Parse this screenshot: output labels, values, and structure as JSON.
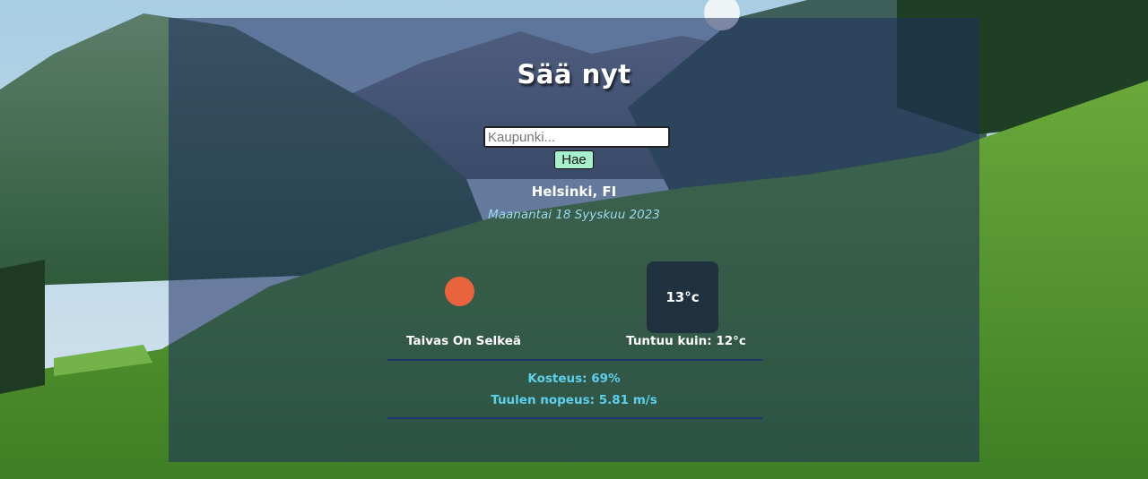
{
  "app": {
    "title": "Sää nyt"
  },
  "search": {
    "placeholder": "Kaupunki...",
    "value": "",
    "button_label": "Hae"
  },
  "location": {
    "city": "Helsinki, FI",
    "date": "Maanantai 18 Syyskuu 2023"
  },
  "current": {
    "icon": "sun-icon",
    "icon_color": "#e8643f",
    "temperature": "13°c",
    "condition": "Taivas On Selkeä",
    "feels_like": "Tuntuu kuin: 12°c"
  },
  "details": {
    "humidity": "Kosteus: 69%",
    "wind": "Tuulen nopeus: 5.81 m/s"
  },
  "colors": {
    "panel": "#1e2d5f",
    "accent": "#5fd0ec",
    "button": "#a7f0cd",
    "divider": "#23356f"
  }
}
